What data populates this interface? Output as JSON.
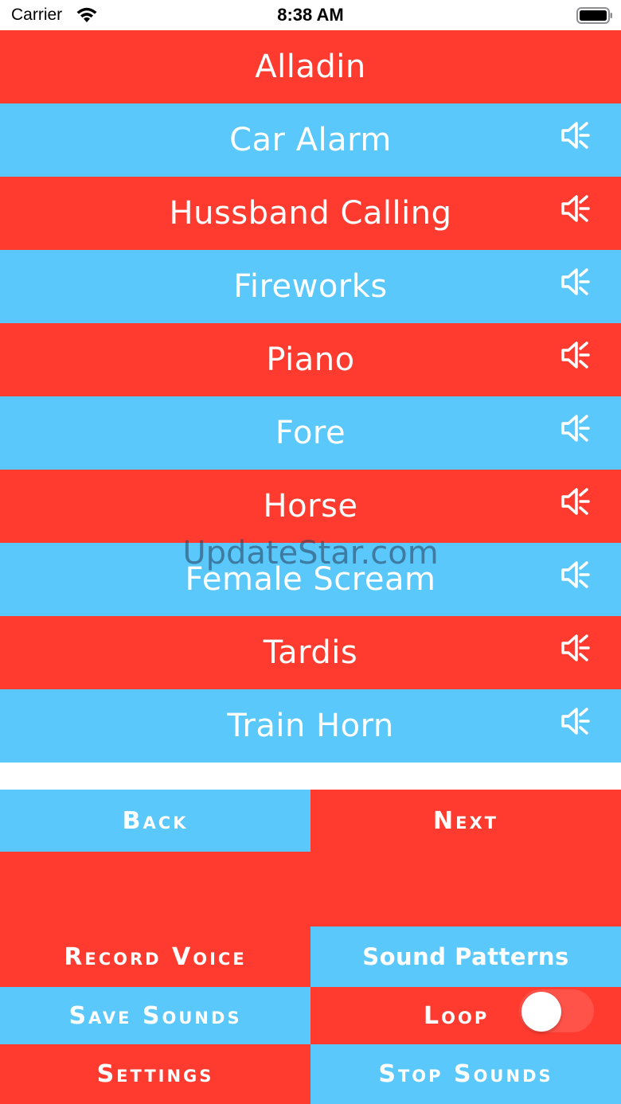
{
  "status_bar": {
    "carrier": "Carrier",
    "time": "8:38 AM"
  },
  "sounds": [
    {
      "label": "Alladin",
      "color": "red",
      "has_speaker": false
    },
    {
      "label": "Car Alarm",
      "color": "blue",
      "has_speaker": true
    },
    {
      "label": "Hussband Calling",
      "color": "red",
      "has_speaker": true
    },
    {
      "label": "Fireworks",
      "color": "blue",
      "has_speaker": true
    },
    {
      "label": "Piano",
      "color": "red",
      "has_speaker": true
    },
    {
      "label": "Fore",
      "color": "blue",
      "has_speaker": true
    },
    {
      "label": "Horse",
      "color": "red",
      "has_speaker": true
    },
    {
      "label": "Female Scream",
      "color": "blue",
      "has_speaker": true
    },
    {
      "label": "Tardis",
      "color": "red",
      "has_speaker": true
    },
    {
      "label": "Train Horn",
      "color": "blue",
      "has_speaker": true
    }
  ],
  "watermark": "UpdateStar.com",
  "controls": {
    "back_label": "Back",
    "next_label": "Next",
    "record_voice_label": "Record Voice",
    "sound_patterns_label": "Sound Patterns",
    "save_sounds_label": "Save Sounds",
    "loop_label": "Loop",
    "loop_on": false,
    "settings_label": "Settings",
    "stop_sounds_label": "Stop Sounds"
  },
  "colors": {
    "red": "#ff3b30",
    "blue": "#5ac8fa",
    "text": "#ffffff"
  },
  "icons": {
    "speaker": "speaker-volume-icon",
    "wifi": "wifi-icon",
    "battery": "battery-icon"
  }
}
